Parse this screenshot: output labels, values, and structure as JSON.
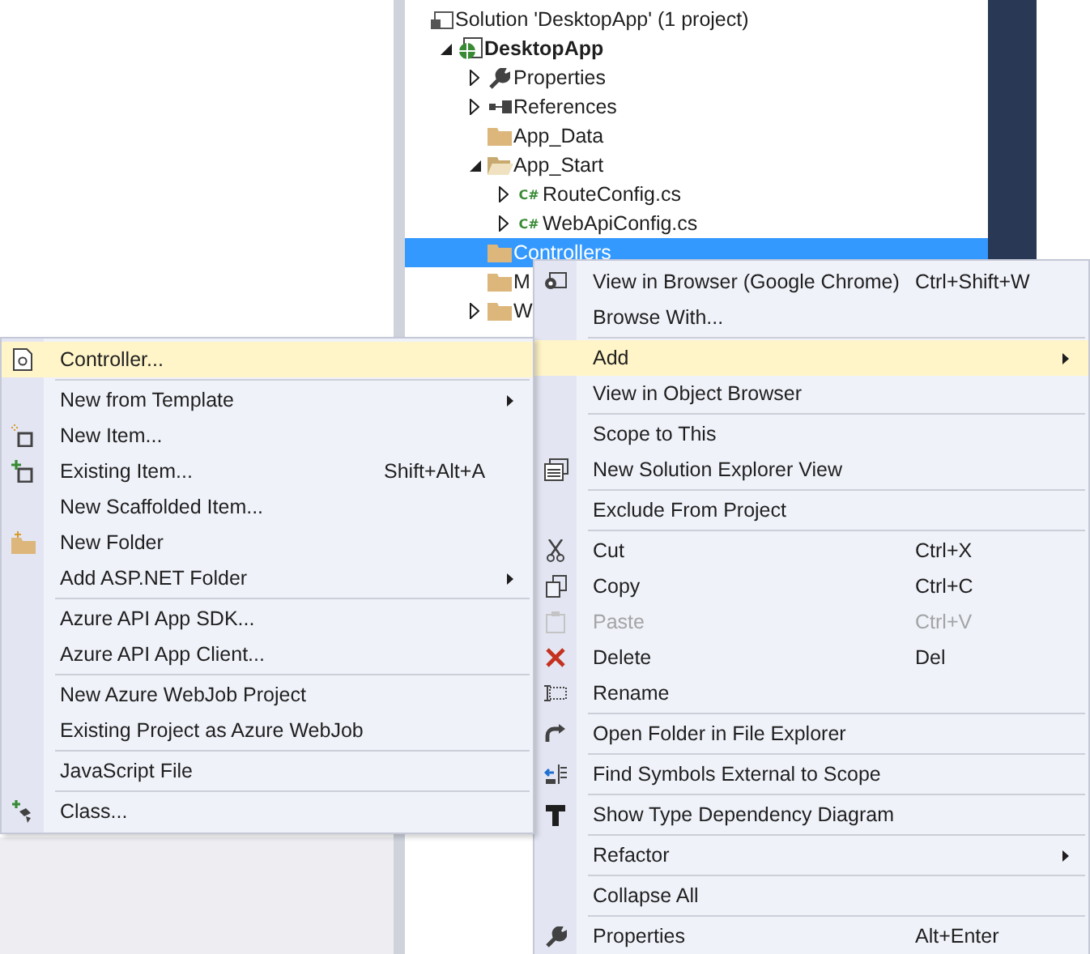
{
  "solution_explorer": {
    "items": [
      {
        "label": "Solution 'DesktopApp' (1 project)",
        "kind": "solution",
        "selected": false,
        "children": [
          {
            "label": "DesktopApp",
            "kind": "project",
            "expanded": true,
            "selected": false,
            "children": [
              {
                "label": "Properties",
                "kind": "wrench",
                "expanded": false,
                "selected": false
              },
              {
                "label": "References",
                "kind": "references",
                "expanded": false,
                "selected": false
              },
              {
                "label": "App_Data",
                "kind": "folder",
                "selected": false
              },
              {
                "label": "App_Start",
                "kind": "folder-open",
                "expanded": true,
                "selected": false,
                "children": [
                  {
                    "label": "RouteConfig.cs",
                    "kind": "csharp",
                    "badge": "C#",
                    "expanded": false,
                    "selected": false
                  },
                  {
                    "label": "WebApiConfig.cs",
                    "kind": "csharp",
                    "badge": "C#",
                    "expanded": false,
                    "selected": false
                  }
                ]
              },
              {
                "label": "Controllers",
                "kind": "folder",
                "selected": true
              },
              {
                "label": "M",
                "kind": "folder",
                "selected": false
              },
              {
                "label": "W",
                "kind": "folder",
                "expanded": false,
                "selected": false
              }
            ]
          }
        ]
      }
    ]
  },
  "context_menu": {
    "items": [
      {
        "kind": "item",
        "label": "View in Browser (Google Chrome)",
        "shortcut": "Ctrl+Shift+W",
        "selected": false,
        "disabled": false
      },
      {
        "kind": "item",
        "label": "Browse With...",
        "selected": false,
        "disabled": false
      },
      {
        "kind": "separator"
      },
      {
        "kind": "submenu",
        "label": "Add",
        "selected": true,
        "disabled": false
      },
      {
        "kind": "item",
        "label": "View in Object Browser",
        "selected": false,
        "disabled": false
      },
      {
        "kind": "separator"
      },
      {
        "kind": "item",
        "label": "Scope to This",
        "selected": false,
        "disabled": false
      },
      {
        "kind": "item",
        "label": "New Solution Explorer View",
        "selected": false,
        "disabled": false
      },
      {
        "kind": "separator"
      },
      {
        "kind": "item",
        "label": "Exclude From Project",
        "selected": false,
        "disabled": false
      },
      {
        "kind": "separator"
      },
      {
        "kind": "item",
        "label": "Cut",
        "shortcut": "Ctrl+X",
        "selected": false,
        "disabled": false
      },
      {
        "kind": "item",
        "label": "Copy",
        "shortcut": "Ctrl+C",
        "selected": false,
        "disabled": false
      },
      {
        "kind": "item",
        "label": "Paste",
        "shortcut": "Ctrl+V",
        "selected": false,
        "disabled": true
      },
      {
        "kind": "item",
        "label": "Delete",
        "shortcut": "Del",
        "selected": false,
        "disabled": false
      },
      {
        "kind": "item",
        "label": "Rename",
        "selected": false,
        "disabled": false
      },
      {
        "kind": "separator"
      },
      {
        "kind": "item",
        "label": "Open Folder in File Explorer",
        "selected": false,
        "disabled": false
      },
      {
        "kind": "separator"
      },
      {
        "kind": "item",
        "label": "Find Symbols External to Scope",
        "selected": false,
        "disabled": false
      },
      {
        "kind": "separator"
      },
      {
        "kind": "item",
        "label": "Show Type Dependency Diagram",
        "selected": false,
        "disabled": false
      },
      {
        "kind": "separator"
      },
      {
        "kind": "submenu",
        "label": "Refactor",
        "selected": false,
        "disabled": false
      },
      {
        "kind": "separator"
      },
      {
        "kind": "item",
        "label": "Collapse All",
        "selected": false,
        "disabled": false
      },
      {
        "kind": "separator"
      },
      {
        "kind": "item",
        "label": "Properties",
        "shortcut": "Alt+Enter",
        "selected": false,
        "disabled": false
      }
    ]
  },
  "add_submenu": {
    "items": [
      {
        "kind": "item",
        "label": "Controller...",
        "selected": true,
        "disabled": false
      },
      {
        "kind": "separator"
      },
      {
        "kind": "submenu",
        "label": "New from Template",
        "selected": false,
        "disabled": false
      },
      {
        "kind": "item",
        "label": "New Item...",
        "selected": false,
        "disabled": false
      },
      {
        "kind": "item",
        "label": "Existing Item...",
        "shortcut": "Shift+Alt+A",
        "selected": false,
        "disabled": false
      },
      {
        "kind": "item",
        "label": "New Scaffolded Item...",
        "selected": false,
        "disabled": false
      },
      {
        "kind": "item",
        "label": "New Folder",
        "selected": false,
        "disabled": false
      },
      {
        "kind": "submenu",
        "label": "Add ASP.NET Folder",
        "selected": false,
        "disabled": false
      },
      {
        "kind": "separator"
      },
      {
        "kind": "item",
        "label": "Azure API App SDK...",
        "selected": false,
        "disabled": false
      },
      {
        "kind": "item",
        "label": "Azure API App Client...",
        "selected": false,
        "disabled": false
      },
      {
        "kind": "separator"
      },
      {
        "kind": "item",
        "label": "New Azure WebJob Project",
        "selected": false,
        "disabled": false
      },
      {
        "kind": "item",
        "label": "Existing Project as Azure WebJob",
        "selected": false,
        "disabled": false
      },
      {
        "kind": "separator"
      },
      {
        "kind": "item",
        "label": "JavaScript File",
        "selected": false,
        "disabled": false
      },
      {
        "kind": "separator"
      },
      {
        "kind": "item",
        "label": "Class...",
        "selected": false,
        "disabled": false
      }
    ]
  }
}
